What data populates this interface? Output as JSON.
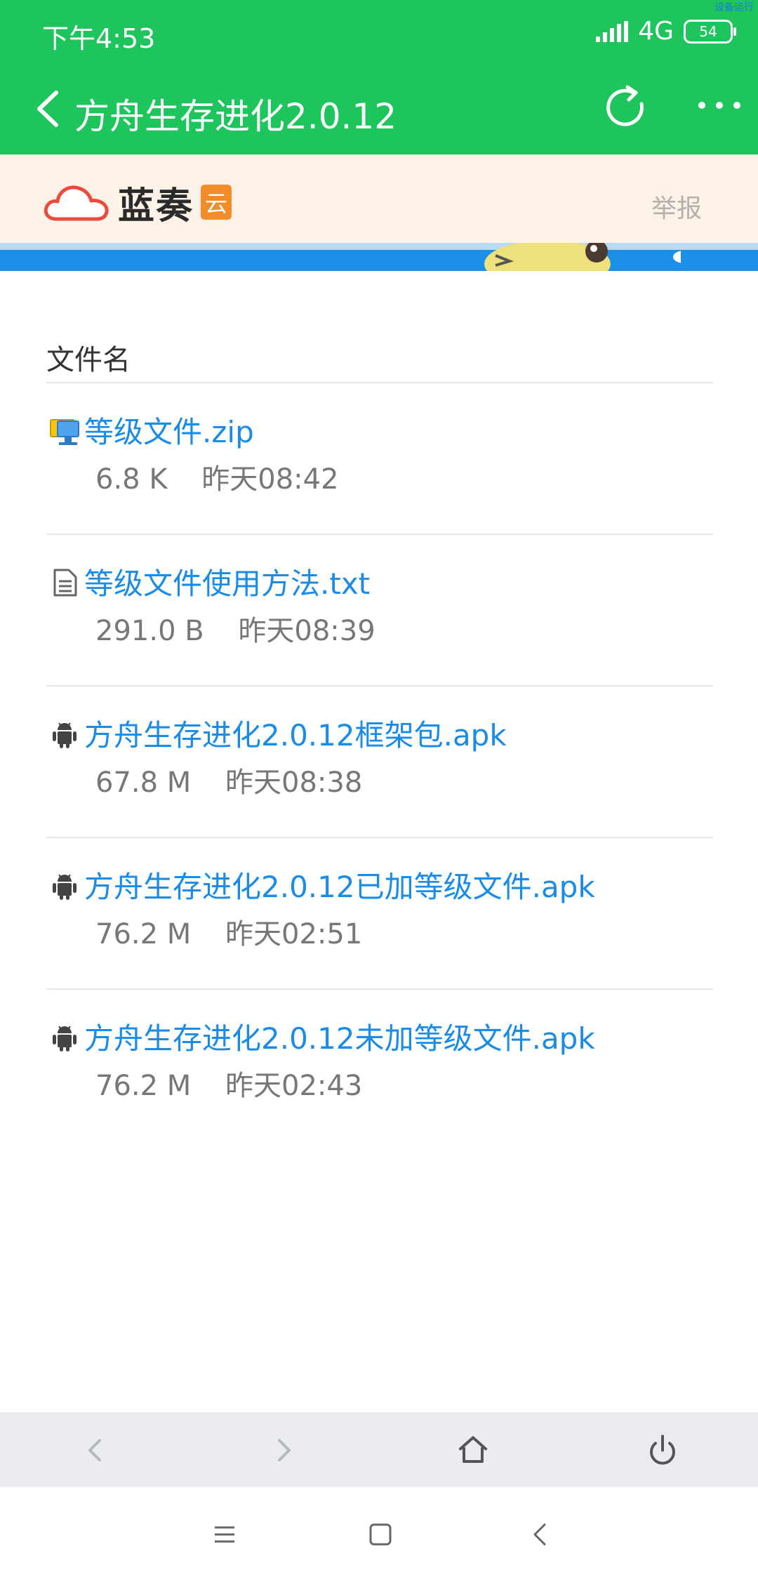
{
  "status_bar": {
    "time": "下午4:53",
    "network": "4G",
    "battery": "54",
    "corner_tag": "设备运行"
  },
  "app_bar": {
    "title": "方舟生存进化2.0.12",
    "icons": [
      "back-arrow-icon",
      "refresh-icon",
      "more-dots-icon"
    ]
  },
  "site_header": {
    "brand": "蓝奏",
    "brand_badge": "云",
    "report_link": "举报"
  },
  "file_list": {
    "header": "文件名",
    "files": [
      {
        "name": "等级文件.zip",
        "size": "6.8 K",
        "time": "昨天08:42",
        "icon": "zip-file-icon"
      },
      {
        "name": "等级文件使用方法.txt",
        "size": "291.0 B",
        "time": "昨天08:39",
        "icon": "text-file-icon"
      },
      {
        "name": "方舟生存进化2.0.12框架包.apk",
        "size": "67.8 M",
        "time": "昨天08:38",
        "icon": "android-icon"
      },
      {
        "name": "方舟生存进化2.0.12已加等级文件.apk",
        "size": "76.2 M",
        "time": "昨天02:51",
        "icon": "android-icon"
      },
      {
        "name": "方舟生存进化2.0.12未加等级文件.apk",
        "size": "76.2 M",
        "time": "昨天02:43",
        "icon": "android-icon"
      }
    ]
  },
  "colors": {
    "app_bar": "#1ec45c",
    "link": "#1a8ce8",
    "header_bg": "#fdf2e8",
    "brand_orange": "#f28c28"
  }
}
